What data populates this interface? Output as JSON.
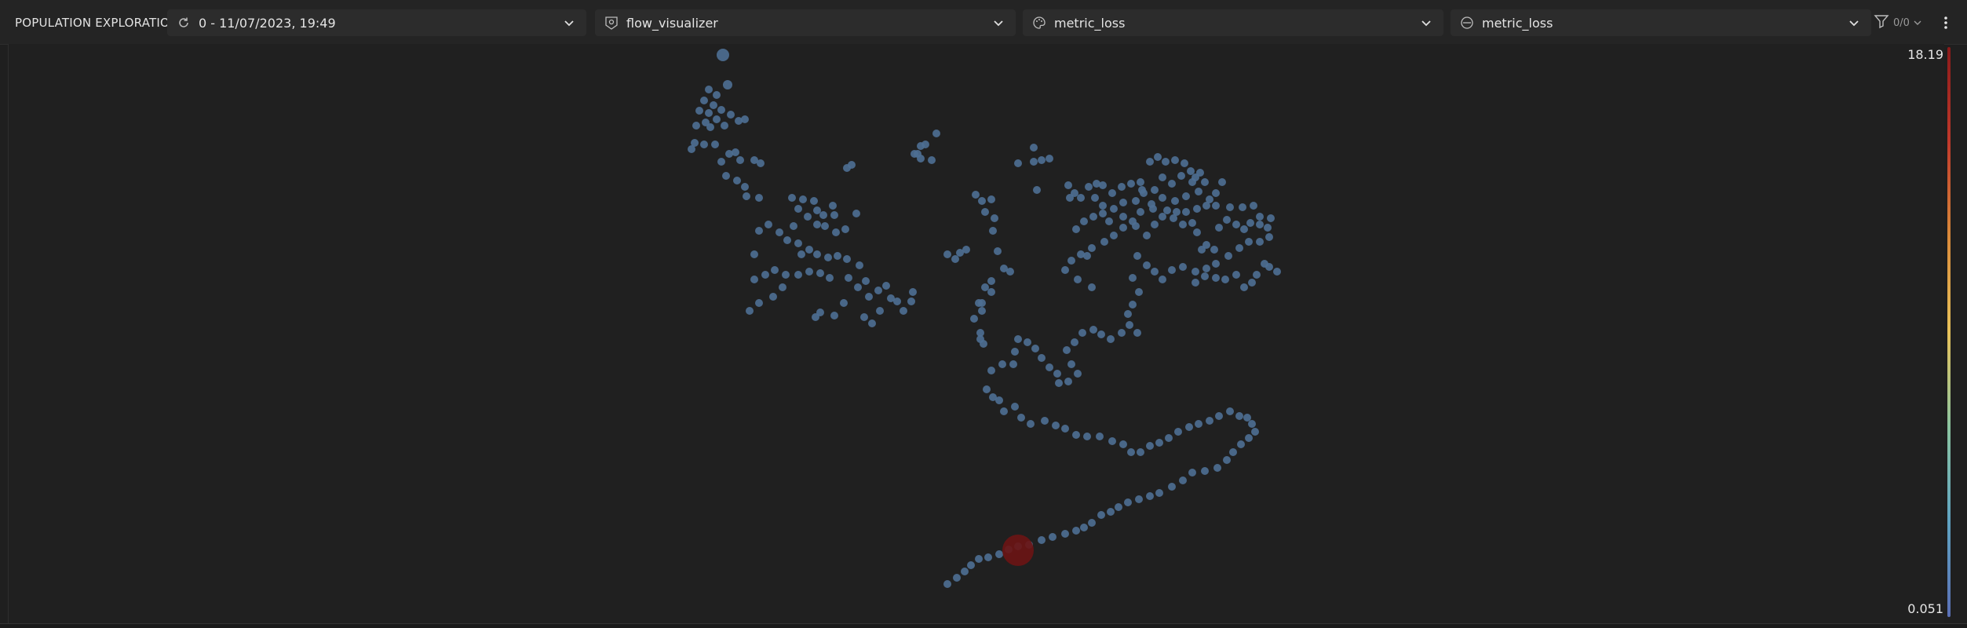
{
  "header": {
    "title": "POPULATION EXPLORATION",
    "dropdowns": [
      {
        "icon": "refresh-icon",
        "label": "0 - 11/07/2023, 19:49"
      },
      {
        "icon": "visualizer-icon",
        "label": "flow_visualizer"
      },
      {
        "icon": "palette-icon",
        "label": "metric_loss"
      },
      {
        "icon": "size-icon",
        "label": "metric_loss"
      }
    ],
    "filter": {
      "icon": "filter-icon",
      "count": "0/0"
    },
    "menu_icon": "kebab-menu-icon"
  },
  "colorscale": {
    "max_label": "18.19",
    "min_label": "0.051",
    "colors": [
      "#8b1a1a",
      "#c0392b",
      "#d98a3a",
      "#e8c25a",
      "#8bc4a0",
      "#5fa3c2",
      "#5a6fb5"
    ]
  },
  "points": {
    "base_color": "#4e6f93",
    "highlight_color": "#6b1414"
  }
}
